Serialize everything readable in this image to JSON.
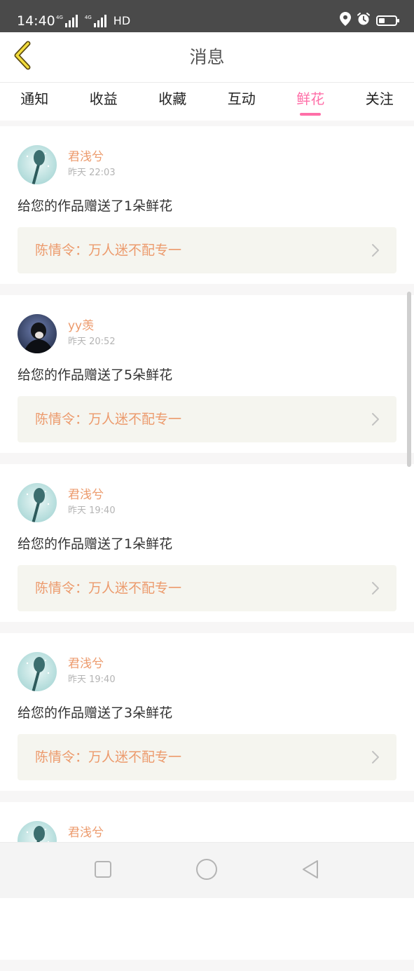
{
  "status_bar": {
    "time": "14:40",
    "net1_label": "4G",
    "net2_label": "4G",
    "hd": "HD",
    "icons": [
      "location-icon",
      "alarm-icon",
      "battery-icon"
    ],
    "battery_level": 0.35
  },
  "header": {
    "back_icon": "chevron-left-icon",
    "title": "消息"
  },
  "tabs": [
    {
      "label": "通知",
      "active": false
    },
    {
      "label": "收益",
      "active": false
    },
    {
      "label": "收藏",
      "active": false
    },
    {
      "label": "互动",
      "active": false
    },
    {
      "label": "鲜花",
      "active": true
    },
    {
      "label": "关注",
      "active": false
    }
  ],
  "colors": {
    "accent_pink": "#ff6fa8",
    "name_orange": "#ec9a6c",
    "work_bg": "#f5f5ef",
    "status_bar": "#4a4a4a"
  },
  "messages": [
    {
      "user": "君浅兮",
      "time": "昨天 22:03",
      "text": "给您的作品赠送了1朵鲜花",
      "work": "陈情令：万人迷不配专一",
      "avatar": "teal"
    },
    {
      "user": "yy羡",
      "time": "昨天 20:52",
      "text": "给您的作品赠送了5朵鲜花",
      "work": "陈情令：万人迷不配专一",
      "avatar": "dark"
    },
    {
      "user": "君浅兮",
      "time": "昨天 19:40",
      "text": "给您的作品赠送了1朵鲜花",
      "work": "陈情令：万人迷不配专一",
      "avatar": "teal"
    },
    {
      "user": "君浅兮",
      "time": "昨天 19:40",
      "text": "给您的作品赠送了3朵鲜花",
      "work": "陈情令：万人迷不配专一",
      "avatar": "teal"
    },
    {
      "user": "君浅兮",
      "time": "",
      "text": "",
      "work": "",
      "avatar": "teal"
    }
  ],
  "nav": {
    "icons": [
      "square-icon",
      "circle-icon",
      "triangle-back-icon"
    ]
  }
}
